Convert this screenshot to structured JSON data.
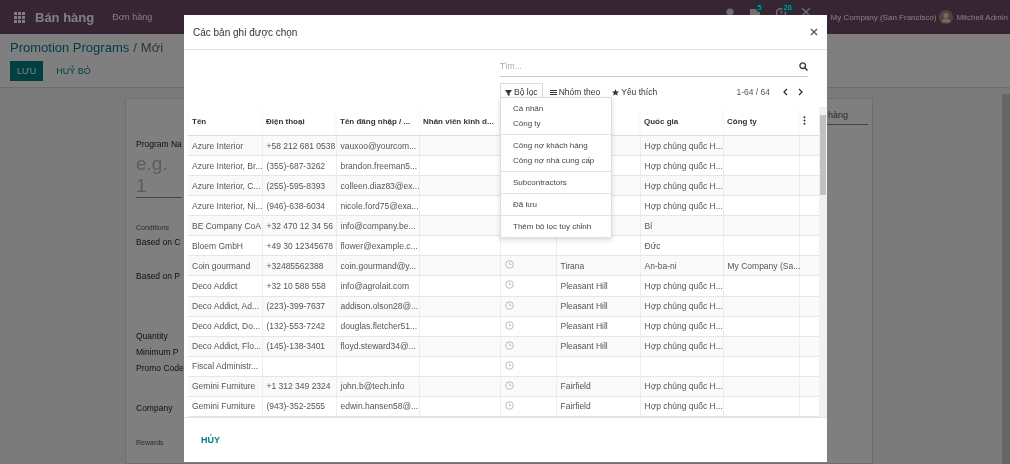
{
  "navbar": {
    "app_name": "Bán hàng",
    "menu": [
      "Đơn hàng"
    ],
    "badges": [
      "5",
      "26"
    ],
    "company": "My Company (San Francisco)",
    "user": "Mitchell Admin"
  },
  "breadcrumb": {
    "parent": "Promotion Programs",
    "separator": "/",
    "current": "Mới"
  },
  "buttons": [
    {
      "label": "LƯU",
      "kind": "primary"
    },
    {
      "label": "HUỶ BỎ",
      "kind": "secondary"
    }
  ],
  "form": {
    "tab": "hàng",
    "items": [
      {
        "text": "Program Na",
        "kind": "label"
      },
      {
        "text": "e.g. 1",
        "kind": "placeholder"
      },
      {
        "text": "Conditions",
        "kind": "section"
      },
      {
        "text": "Based on C",
        "kind": "label"
      },
      {
        "text": "Based on P",
        "kind": "label"
      },
      {
        "text": "Quantity",
        "kind": "label"
      },
      {
        "text": "Minimum P",
        "kind": "label"
      },
      {
        "text": "Promo Code",
        "kind": "label"
      },
      {
        "text": "Company",
        "kind": "label"
      },
      {
        "text": "Rewards",
        "kind": "section"
      }
    ]
  },
  "modal": {
    "title": "Các bản ghi được chọn",
    "search": {
      "placeholder": "Tìm..."
    },
    "filters": [
      {
        "label": "Bộ lọc",
        "kind": "filter",
        "selected": true
      },
      {
        "label": "Nhóm theo",
        "kind": "group",
        "selected": false
      },
      {
        "label": "Yêu thích",
        "kind": "favorite",
        "selected": false
      }
    ],
    "pager": "1-64 / 64",
    "filter_menu": [
      [
        "Cá nhân",
        "Công ty"
      ],
      [
        "Công nợ khách hàng",
        "Công nợ nhà cung cấp"
      ],
      [
        "Subcontractors"
      ],
      [
        "Đã lưu"
      ],
      [
        "Thêm bộ lọc tùy chỉnh"
      ]
    ],
    "columns": [
      "Tên",
      "Điện thoại",
      "Tên đăng nhập / ...",
      "Nhân viên kinh d...",
      "Quốc gia",
      "Công ty"
    ],
    "rows": [
      {
        "name": "Azure Interior",
        "phone": "+58 212 681 0538",
        "login": "vauxoo@yourcom...",
        "country": "Hợp chủng quốc H..."
      },
      {
        "name": "Azure Interior, Br...",
        "phone": "(355)-687-3262",
        "login": "brandon.freeman5...",
        "country": "Hợp chủng quốc H..."
      },
      {
        "name": "Azure Interior, C...",
        "phone": "(255)-595-8393",
        "login": "colleen.diaz83@ex...",
        "country": "Hợp chủng quốc H..."
      },
      {
        "name": "Azure Interior, Ni...",
        "phone": "(946)-638-6034",
        "login": "nicole.ford75@exa...",
        "country": "Hợp chủng quốc H..."
      },
      {
        "name": "BE Company CoA",
        "phone": "+32 470 12 34 56",
        "login": "info@company.be...",
        "country": "Bỉ"
      },
      {
        "name": "Bloem GmbH",
        "phone": "+49 30 12345678",
        "login": "flower@example.c...",
        "country": "Đức"
      },
      {
        "name": "Coin gourmand",
        "phone": "+32485562388",
        "login": "coin.gourmand@y...",
        "activity": true,
        "city": "Tirana",
        "country": "An-ba-ni",
        "company": "My Company (Sa..."
      },
      {
        "name": "Deco Addict",
        "phone": "+32 10 588 558",
        "login": "info@agrolait.com",
        "activity": true,
        "city": "Pleasant Hill",
        "country": "Hợp chủng quốc H..."
      },
      {
        "name": "Deco Addict, Ad...",
        "phone": "(223)-399-7637",
        "login": "addison.olson28@...",
        "activity": true,
        "city": "Pleasant Hill",
        "country": "Hợp chủng quốc H..."
      },
      {
        "name": "Deco Addict, Do...",
        "phone": "(132)-553-7242",
        "login": "douglas.fletcher51...",
        "activity": true,
        "city": "Pleasant Hill",
        "country": "Hợp chủng quốc H..."
      },
      {
        "name": "Deco Addict, Flo...",
        "phone": "(145)-138-3401",
        "login": "floyd.steward34@...",
        "activity": true,
        "city": "Pleasant Hill",
        "country": "Hợp chủng quốc H..."
      },
      {
        "name": "Fiscal Administr...",
        "activity": true
      },
      {
        "name": "Gemini Furniture",
        "phone": "+1 312 349 2324",
        "login": "john.b@tech.info",
        "activity": true,
        "city": "Fairfield",
        "country": "Hợp chủng quốc H..."
      },
      {
        "name": "Gemini Furniture",
        "phone": "(943)-352-2555",
        "login": "edwin.hansen58@...",
        "activity": true,
        "city": "Fairfield",
        "country": "Hợp chủng quốc H..."
      }
    ],
    "footer_button": "HỦY"
  }
}
